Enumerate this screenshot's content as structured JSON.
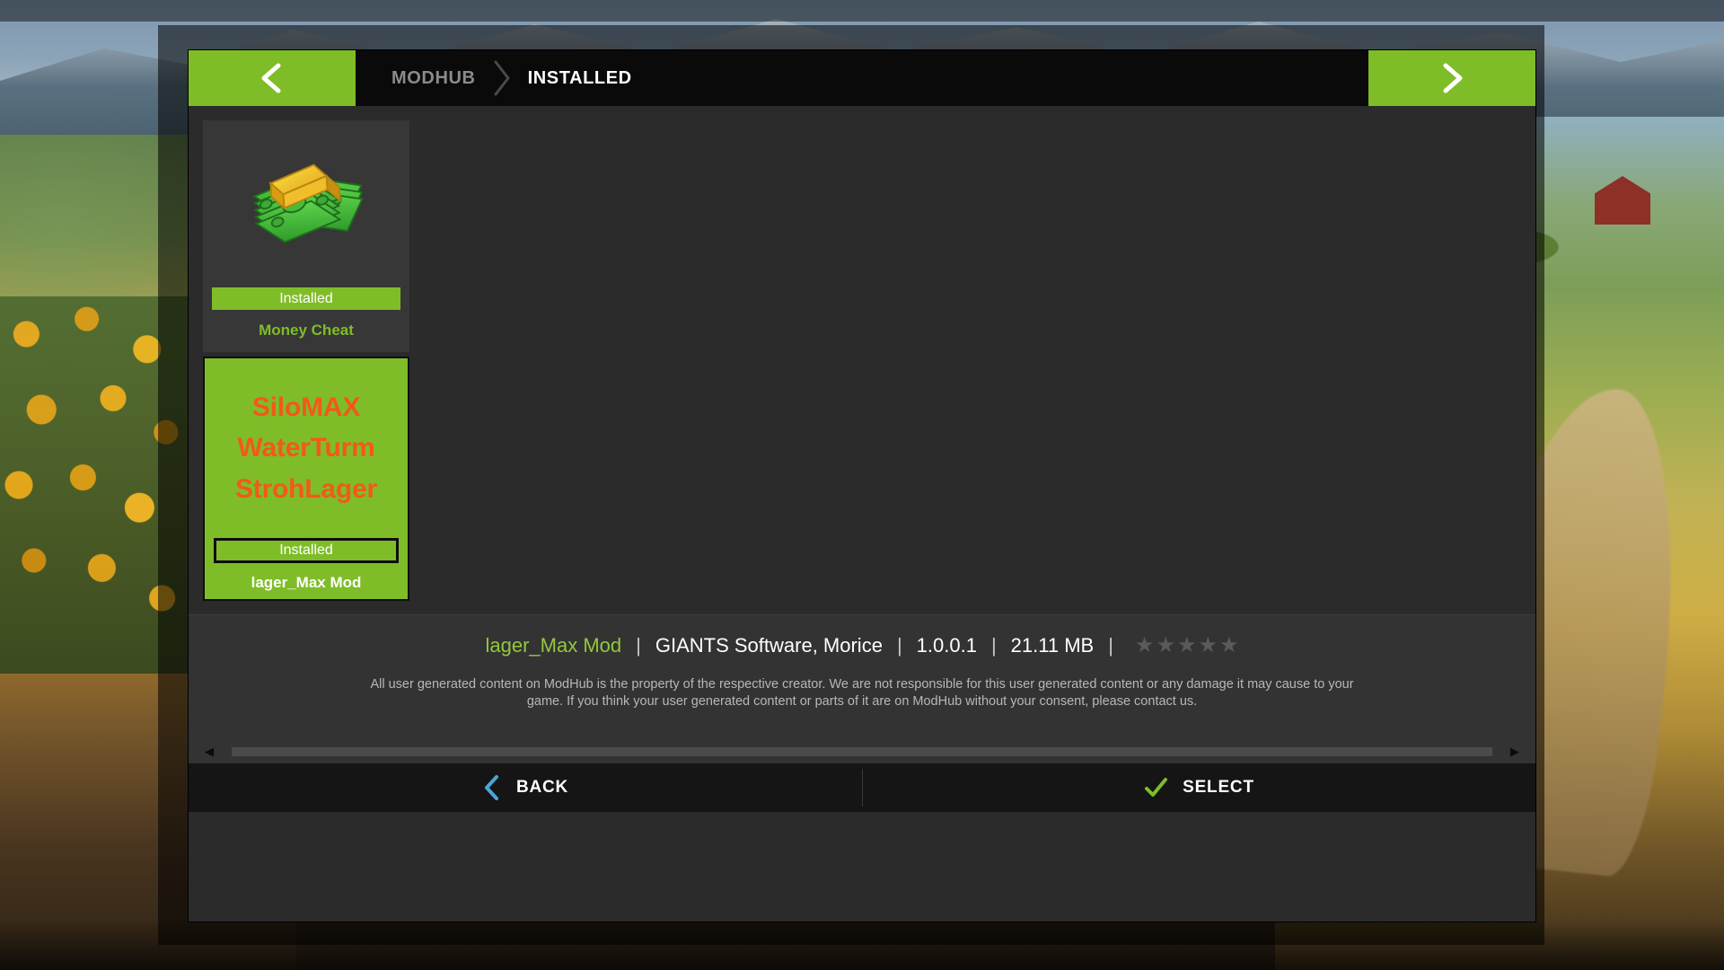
{
  "header": {
    "prev_arrow": "chevron-left",
    "next_arrow": "chevron-right",
    "breadcrumbs": [
      {
        "label": "MODHUB",
        "active": false
      },
      {
        "label": "INSTALLED",
        "active": true
      }
    ]
  },
  "colors": {
    "accent_green": "#7fbd28",
    "title_green": "#93c83d",
    "tile_orange": "#f4581a",
    "back_blue": "#4aa6d8",
    "panel_dark": "#2b2b2b",
    "infobar": "#333333"
  },
  "mods": [
    {
      "id": "money-cheat",
      "title": "Money Cheat",
      "status": "Installed",
      "thumb_type": "image",
      "thumb_icon": "money-stack-icon",
      "selected": false
    },
    {
      "id": "lager-max-mod",
      "title": "lager_Max Mod",
      "status": "Installed",
      "thumb_type": "text",
      "thumb_lines": [
        "SiloMAX",
        "WaterTurm",
        "StrohLager"
      ],
      "selected": true
    }
  ],
  "info": {
    "name": "lager_Max Mod",
    "author": "GIANTS Software, Morice",
    "version": "1.0.0.1",
    "size": "21.11 MB",
    "separator": "|",
    "rating": 0,
    "rating_max": 5,
    "star_glyph": "★",
    "disclaimer": "All user generated content on ModHub is the property of the respective creator. We are not responsible for this user generated content or any damage it may cause to your game. If you think your user generated content or parts of it are on ModHub without your consent, please contact us."
  },
  "scrollbar": {
    "left_arrow": "triangle-left-icon",
    "right_arrow": "triangle-right-icon",
    "left_glyph": "◀",
    "right_glyph": "▶"
  },
  "buttons": [
    {
      "id": "back",
      "label": "BACK",
      "icon": "chevron-left-icon"
    },
    {
      "id": "select",
      "label": "SELECT",
      "icon": "check-icon"
    }
  ]
}
